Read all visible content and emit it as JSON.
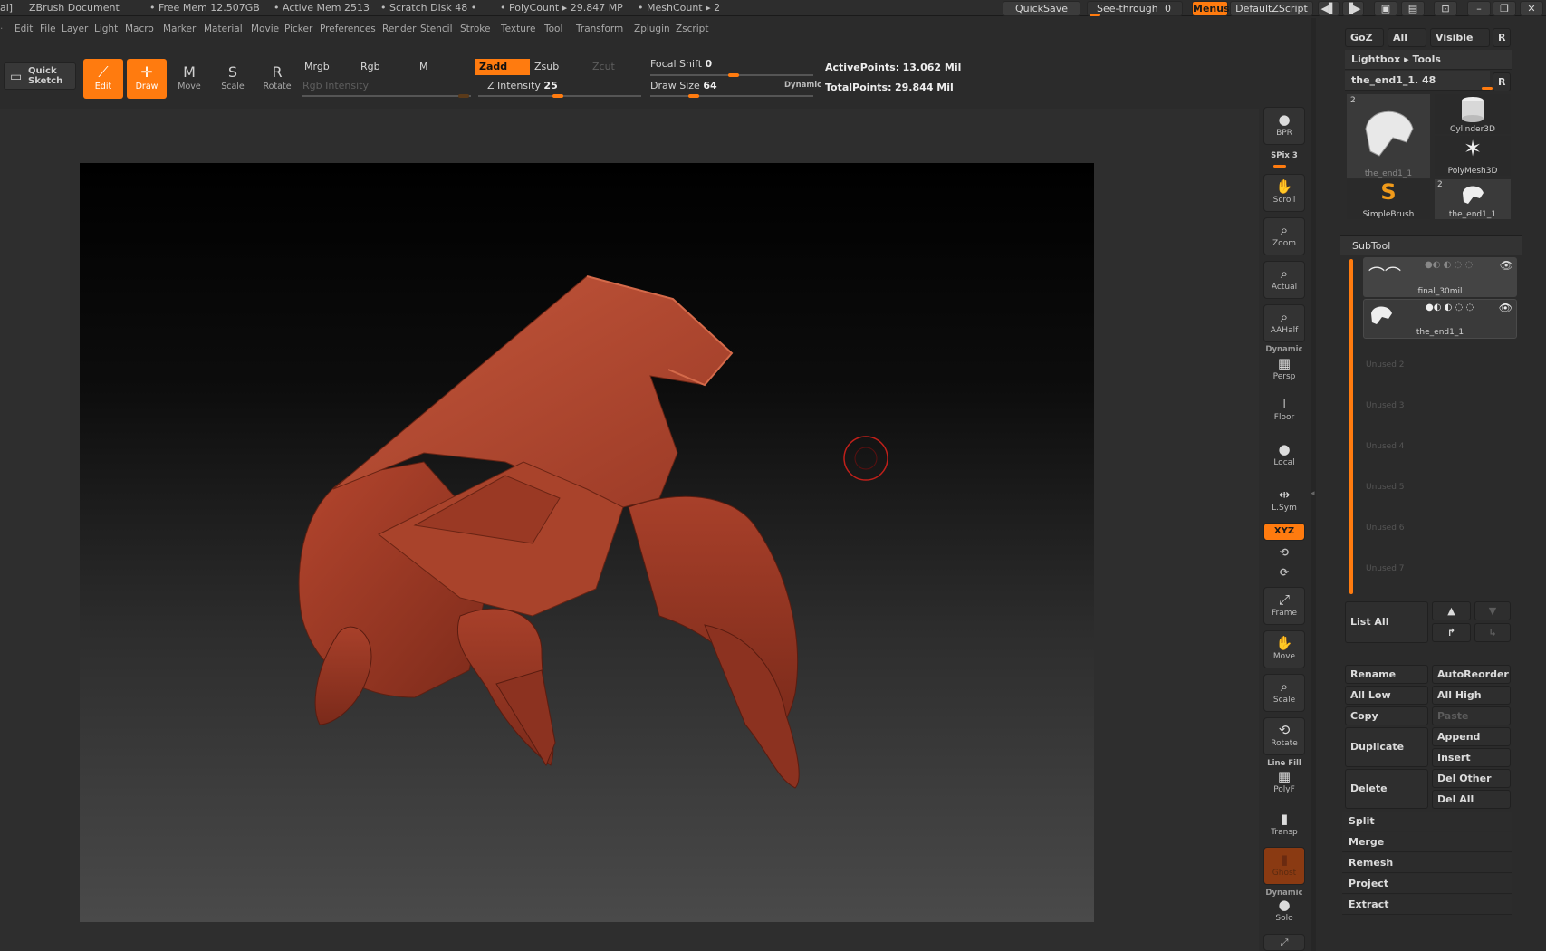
{
  "titlebar": {
    "doc": "ZBrush Document",
    "free_mem": "• Free Mem 12.507GB",
    "active_mem": "• Active Mem 2513",
    "scratch": "• Scratch Disk 48 •",
    "polycount": "• PolyCount ▸ 29.847 MP",
    "meshcount": "• MeshCount ▸ 2",
    "prefix": "al]",
    "quicksave": "QuickSave",
    "see_through": "See-through",
    "see_through_value": "0",
    "menus": "Menus",
    "script": "DefaultZScript"
  },
  "menu": [
    "Edit",
    "File",
    "Layer",
    "Light",
    "Macro",
    "Marker",
    "Material",
    "Movie",
    "Picker",
    "Preferences",
    "Render",
    "Stencil",
    "Stroke",
    "Texture",
    "Tool",
    "Transform",
    "Zplugin",
    "Zscript"
  ],
  "toolbar": {
    "quick_sketch": "Quick Sketch",
    "tools": [
      {
        "label": "Edit",
        "icon": "edit-icon"
      },
      {
        "label": "Draw",
        "icon": "draw-icon"
      },
      {
        "label": "Move",
        "icon": "move-icon"
      },
      {
        "label": "Scale",
        "icon": "scale-icon"
      },
      {
        "label": "Rotate",
        "icon": "rotate-icon"
      }
    ],
    "mrgb": "Mrgb",
    "rgb": "Rgb",
    "m": "M",
    "zadd": "Zadd",
    "zsub": "Zsub",
    "zcut": "Zcut",
    "rgb_intensity": "Rgb Intensity",
    "z_intensity_label": "Z Intensity",
    "z_intensity": "25",
    "focal_label": "Focal Shift",
    "focal": "0",
    "draw_size_label": "Draw Size",
    "draw_size": "64",
    "dynamic": "Dynamic",
    "active_points_label": "ActivePoints:",
    "active_points": "13.062 Mil",
    "total_points_label": "TotalPoints:",
    "total_points": "29.844 Mil"
  },
  "shelf": {
    "bpr": "BPR",
    "spix_label": "SPix",
    "spix": "3",
    "buttons": [
      {
        "label": "Scroll",
        "icon": "scroll-hand-icon"
      },
      {
        "label": "Zoom",
        "icon": "zoom-icon"
      },
      {
        "label": "Actual",
        "icon": "actual-icon"
      },
      {
        "label": "AAHalf",
        "icon": "aahalf-icon"
      }
    ],
    "dynamic": "Dynamic",
    "persp": "Persp",
    "floor": "Floor",
    "local": "Local",
    "lsym": "L.Sym",
    "xyz": "XYZ",
    "frame": "Frame",
    "move": "Move",
    "scale": "Scale",
    "rotate": "Rotate",
    "line_fill": "Line Fill",
    "polyf": "PolyF",
    "transp": "Transp",
    "ghost": "Ghost",
    "dynamic2": "Dynamic",
    "solo": "Solo"
  },
  "panel": {
    "goz": "GoZ",
    "all": "All",
    "visible": "Visible",
    "r": "R",
    "lightbox": "Lightbox ▸ Tools",
    "tool_name": "the_end1_1. 48",
    "tools": [
      {
        "name": "the_end1_1",
        "count": "2"
      },
      {
        "name": "Cylinder3D"
      },
      {
        "name": "PolyMesh3D"
      },
      {
        "name": "SimpleBrush"
      },
      {
        "name": "the_end1_1",
        "count": "2"
      }
    ],
    "subtool_title": "SubTool",
    "subtools": [
      {
        "name": "final_30mil"
      },
      {
        "name": "the_end1_1"
      }
    ],
    "unused": [
      "Unused 2",
      "Unused 3",
      "Unused 4",
      "Unused 5",
      "Unused 6",
      "Unused 7"
    ],
    "list_all": "List All",
    "rename": "Rename",
    "autoreorder": "AutoReorder",
    "all_low": "All Low",
    "all_high": "All High",
    "copy": "Copy",
    "paste": "Paste",
    "duplicate": "Duplicate",
    "append": "Append",
    "insert": "Insert",
    "delete": "Delete",
    "del_other": "Del Other",
    "del_all": "Del All",
    "split": "Split",
    "merge": "Merge",
    "remesh": "Remesh",
    "project": "Project",
    "extract": "Extract"
  },
  "colors": {
    "accent": "#ff7b0f",
    "model": "#b8442c",
    "bg": "#2b2b2b"
  }
}
